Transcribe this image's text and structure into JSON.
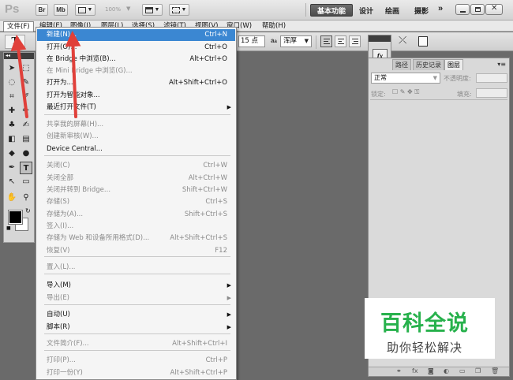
{
  "app": {
    "logo": "Ps",
    "bridge_label": "Br",
    "minibridge_label": "Mb",
    "zoom": "100%",
    "workspaces": {
      "essentials": "基本功能",
      "design": "设计",
      "painting": "绘画",
      "photography": "摄影",
      "more": "»"
    }
  },
  "menubar": [
    "文件(F)",
    "编辑(E)",
    "图像(I)",
    "图层(L)",
    "选择(S)",
    "滤镜(T)",
    "视图(V)",
    "窗口(W)",
    "帮助(H)"
  ],
  "options": {
    "tool_preset": "T",
    "font_size": "15 点",
    "aa_icon": "a",
    "aa_icon2": "a",
    "antialias": "浑厚"
  },
  "file_menu": {
    "items": [
      {
        "label": "新建(N)...",
        "shortcut": "Ctrl+N",
        "highlighted": true
      },
      {
        "label": "打开(O)...",
        "shortcut": "Ctrl+O"
      },
      {
        "label": "在 Bridge 中浏览(B)...",
        "shortcut": "Alt+Ctrl+O"
      },
      {
        "label": "在 Mini Bridge 中浏览(G)...",
        "shortcut": "",
        "disabled": true
      },
      {
        "label": "打开为...",
        "shortcut": "Alt+Shift+Ctrl+O"
      },
      {
        "label": "打开为智能对象...",
        "shortcut": ""
      },
      {
        "label": "最近打开文件(T)",
        "shortcut": "",
        "submenu": true
      },
      {
        "label": "共享我的屏幕(H)...",
        "shortcut": "",
        "disabled": true
      },
      {
        "label": "创建新审核(W)...",
        "shortcut": "",
        "disabled": true
      },
      {
        "label": "Device Central...",
        "shortcut": ""
      },
      {
        "label": "关闭(C)",
        "shortcut": "Ctrl+W",
        "disabled": true
      },
      {
        "label": "关闭全部",
        "shortcut": "Alt+Ctrl+W",
        "disabled": true
      },
      {
        "label": "关闭并转到 Bridge...",
        "shortcut": "Shift+Ctrl+W",
        "disabled": true
      },
      {
        "label": "存储(S)",
        "shortcut": "Ctrl+S",
        "disabled": true
      },
      {
        "label": "存储为(A)...",
        "shortcut": "Shift+Ctrl+S",
        "disabled": true
      },
      {
        "label": "签入(I)...",
        "shortcut": "",
        "disabled": true
      },
      {
        "label": "存储为 Web 和设备所用格式(D)...",
        "shortcut": "Alt+Shift+Ctrl+S",
        "disabled": true
      },
      {
        "label": "恢复(V)",
        "shortcut": "F12",
        "disabled": true
      },
      {
        "label": "置入(L)...",
        "shortcut": "",
        "disabled": true
      },
      {
        "label": "导入(M)",
        "shortcut": "",
        "submenu": true
      },
      {
        "label": "导出(E)",
        "shortcut": "",
        "submenu": true,
        "disabled": true
      },
      {
        "label": "自动(U)",
        "shortcut": "",
        "submenu": true
      },
      {
        "label": "脚本(R)",
        "shortcut": "",
        "submenu": true
      },
      {
        "label": "文件简介(F)...",
        "shortcut": "Alt+Shift+Ctrl+I",
        "disabled": true
      },
      {
        "label": "打印(P)...",
        "shortcut": "Ctrl+P",
        "disabled": true
      },
      {
        "label": "打印一份(Y)",
        "shortcut": "Alt+Shift+Ctrl+P",
        "disabled": true
      }
    ]
  },
  "layers_panel": {
    "tabs": [
      "路径",
      "历史记录",
      "图层"
    ],
    "blend_mode": "正常",
    "opacity_label": "不透明度:",
    "lock_label": "锁定:",
    "fill_label": "填充:",
    "mini_icon": "fx"
  },
  "watermark": {
    "title": "百科全说",
    "subtitle": "助你轻松解决"
  },
  "colors": {
    "highlight": "#3b87d2",
    "watermark_green": "#27b14c",
    "arrow_red": "#e0403a"
  }
}
